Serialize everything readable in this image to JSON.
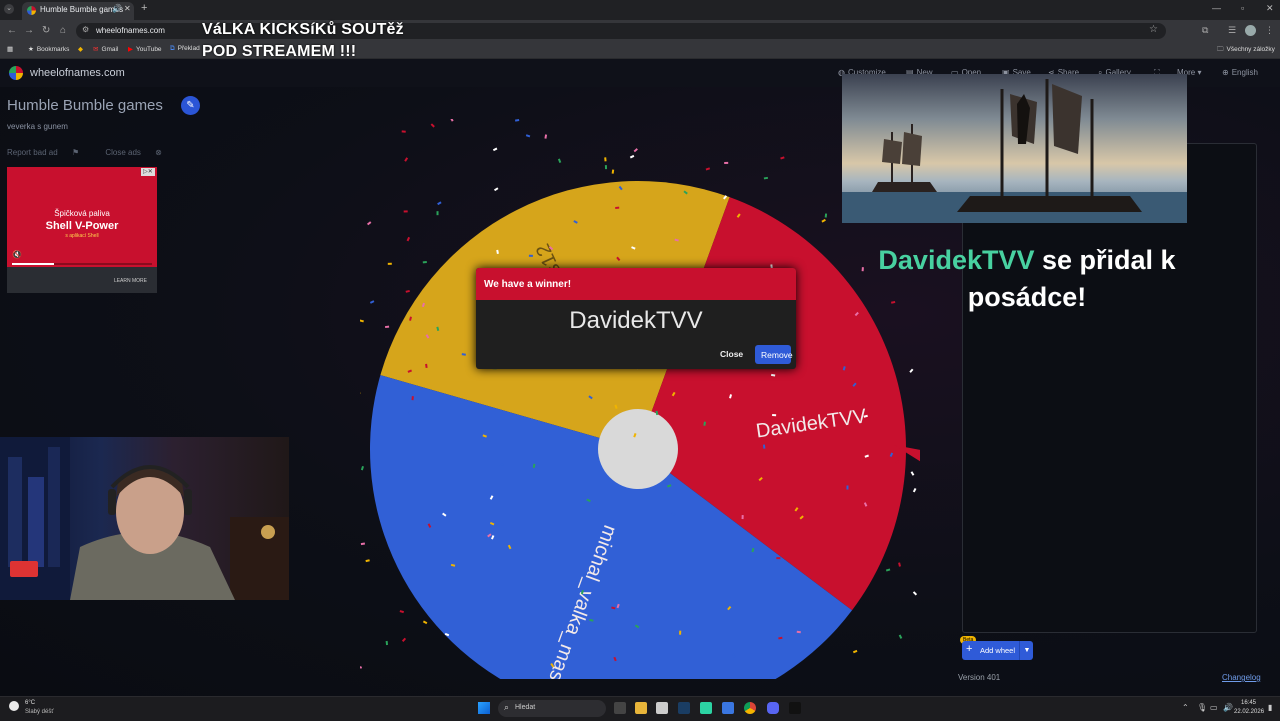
{
  "browser": {
    "tab_title": "Humble Bumble games",
    "url": "wheelofnames.com",
    "bookmarks": [
      {
        "label": "Bookmarks",
        "icon": "star-icon"
      },
      {
        "label": "Gmail",
        "icon": "gmail-icon"
      },
      {
        "label": "YouTube",
        "icon": "youtube-icon"
      },
      {
        "label": "Překlad",
        "icon": "translate-icon"
      }
    ],
    "all_bookmarks": "Všechny záložky"
  },
  "stream_overlay": {
    "title_line1": "VáLKA KICKSíKů SOUTěž",
    "title_line2": "POD STREAMEM !!!",
    "join_name": "DavidekTVV",
    "join_text": " se přidal k posádce!"
  },
  "site": {
    "name": "wheelofnames.com",
    "nav": [
      "Customize",
      "New",
      "Open",
      "Save",
      "Share",
      "Gallery",
      "More",
      "English"
    ],
    "wheel_title": "Humble Bumble games",
    "wheel_description": "veverka s gunem",
    "report_ad": "Report bad ad",
    "close_ads": "Close ads"
  },
  "ad": {
    "line1": "Špičková paliva",
    "line2": "Shell V-Power",
    "line3": "s aplikací Shell",
    "cta": "LEARN MORE",
    "progress": 0.3
  },
  "wheel": {
    "segments": [
      {
        "label": "Ekramos12",
        "color": "#d6a51b"
      },
      {
        "label": "DavidekTVV",
        "color": "#c8102e"
      },
      {
        "label": "michal_valka_mast...",
        "color": "#3160d6"
      }
    ]
  },
  "dialog": {
    "title": "We have a winner!",
    "winner": "DavidekTVV",
    "close_label": "Close",
    "remove_label": "Remove"
  },
  "right_panel": {
    "beta_badge": "Beta",
    "add_wheel_label": "Add wheel",
    "version": "Version 401",
    "changelog": "Changelog"
  },
  "taskbar": {
    "temperature": "6°C",
    "weather": "Slabý déšť",
    "search_placeholder": "Hledat",
    "time": "16:45",
    "date": "22.02.2026"
  },
  "colors": {
    "accent_blue": "#2f5bd8",
    "accent_red": "#c8102e",
    "accent_yellow": "#d6a51b",
    "join_name_green": "#48d1a0"
  }
}
